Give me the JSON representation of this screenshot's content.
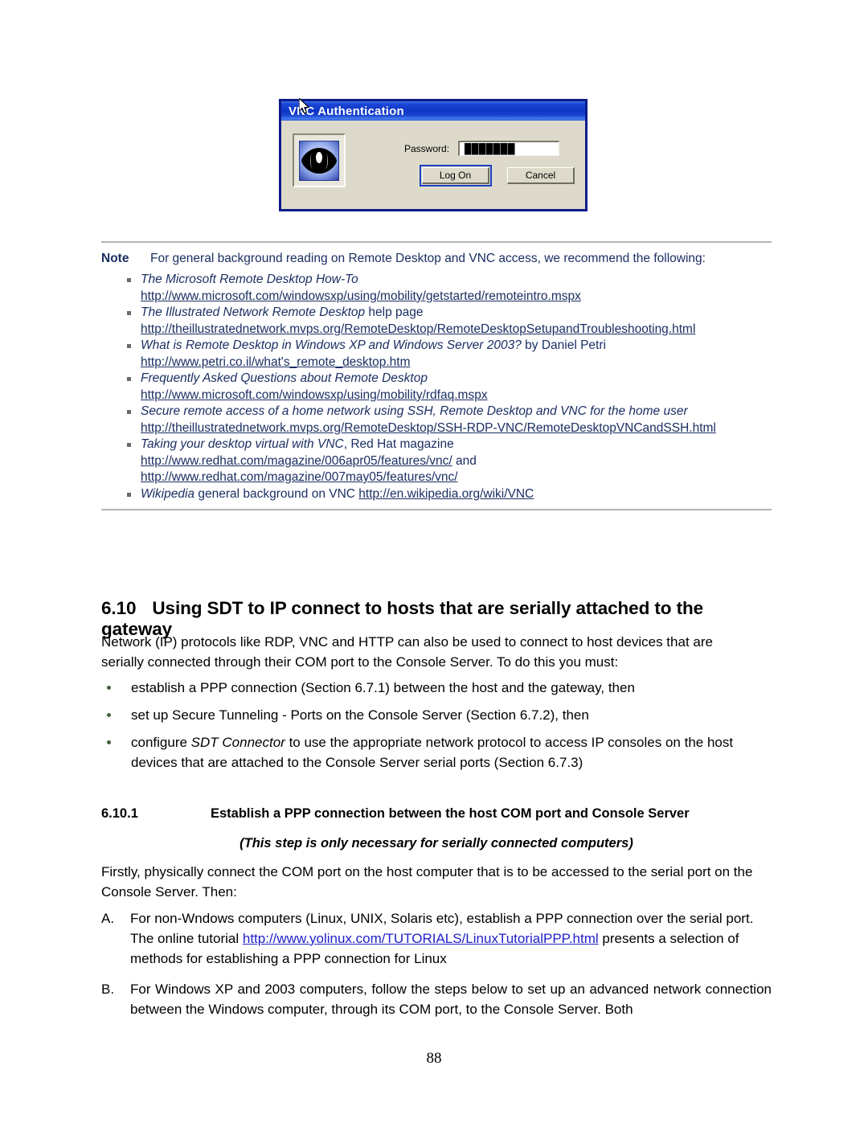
{
  "vnc_dialog": {
    "title": "VNC Authentication",
    "password_label": "Password:",
    "password_value": "███████",
    "logon_button": "Log On",
    "cancel_button": "Cancel",
    "icon_name": "vnc-eye-icon",
    "colors": {
      "titlebar": "#1b47d4",
      "dialog_face": "#dedacb",
      "border": "#0c1b8a"
    }
  },
  "note": {
    "label": "Note",
    "intro": "For general background reading on Remote Desktop and VNC access, we recommend the following:",
    "text_color": "#1b2f63",
    "items": [
      {
        "title": "The Microsoft Remote Desktop How-To",
        "title_italic": true,
        "title_suffix": "",
        "urls": [
          "http://www.microsoft.com/windowsxp/using/mobility/getstarted/remoteintro.mspx"
        ]
      },
      {
        "title": "The Illustrated Network Remote Desktop",
        "title_italic": true,
        "title_suffix": " help page",
        "urls": [
          "http://theillustratednetwork.mvps.org/RemoteDesktop/RemoteDesktopSetupandTroubleshooting.html"
        ]
      },
      {
        "title": "What is Remote Desktop in Windows XP and Windows Server 2003?",
        "title_italic": true,
        "title_suffix": "  by Daniel Petri",
        "urls": [
          "http://www.petri.co.il/what's_remote_desktop.htm"
        ]
      },
      {
        "title": "Frequently Asked Questions about Remote Desktop",
        "title_italic": true,
        "title_suffix": "",
        "urls": [
          "http://www.microsoft.com/windowsxp/using/mobility/rdfaq.mspx"
        ]
      },
      {
        "title": "Secure remote access of a home network using SSH, Remote Desktop and VNC for the home user",
        "title_italic": true,
        "title_suffix": "",
        "urls": [
          "http://theillustratednetwork.mvps.org/RemoteDesktop/SSH-RDP-VNC/RemoteDesktopVNCandSSH.html"
        ]
      },
      {
        "title": "Taking your desktop virtual with VNC",
        "title_italic": true,
        "title_suffix": ", Red Hat magazine",
        "urls": [
          "http://www.redhat.com/magazine/006apr05/features/vnc/",
          "http://www.redhat.com/magazine/007may05/features/vnc/"
        ],
        "url_joiner": " and "
      },
      {
        "title": "Wikipedia",
        "title_italic": true,
        "title_suffix": " general background on VNC ",
        "inline_url": "http://en.wikipedia.org/wiki/VNC",
        "urls": []
      }
    ]
  },
  "section": {
    "number": "6.10",
    "title": "Using SDT to IP connect to hosts that are serially attached to the gateway",
    "intro": "Network (IP) protocols like RDP, VNC and HTTP can also be used to connect to host devices that are serially connected through their COM port to the Console Server. To do this you must:",
    "bullets": [
      "establish a PPP connection (Section 6.7.1) between the host and the gateway, then",
      "set up Secure Tunneling - Ports on the Console Server (Section 6.7.2), then",
      "configure SDT Connector to use the appropriate network protocol to access IP consoles on the host devices that are attached to the Console Server serial ports (Section 6.7.3)"
    ],
    "bullet3_parts": {
      "pre": "configure ",
      "italic": "SDT Connector",
      "post": " to use the appropriate network protocol to access IP consoles on the host devices that are attached to the Console Server serial ports (Section 6.7.3)"
    }
  },
  "subsection": {
    "number": "6.10.1",
    "title": "Establish a PPP connection between the host COM port and Console Server",
    "subtitle": "(This step is only necessary for serially connected computers)",
    "intro": "Firstly, physically connect the COM port on the host computer that is to be accessed to the serial port on the Console Server. Then:",
    "items": [
      {
        "marker": "A.",
        "pre": "For non-Wndows computers (Linux, UNIX, Solaris etc), establish a PPP connection over the serial port. The online tutorial ",
        "link": "http://www.yolinux.com/TUTORIALS/LinuxTutorialPPP.html",
        "post": " presents a selection of methods for establishing a PPP connection for Linux",
        "justified": false
      },
      {
        "marker": "B.",
        "pre": "For Windows XP and 2003 computers, follow the steps below to set up an advanced network connection between the Windows computer, through its COM port, to the Console Server. Both",
        "link": "",
        "post": "",
        "justified": true
      }
    ]
  },
  "footer": {
    "page_number": "88"
  }
}
